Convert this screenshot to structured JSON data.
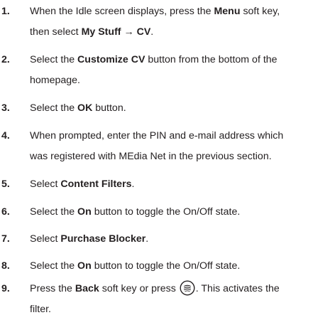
{
  "steps": [
    {
      "number": "1.",
      "line1": [
        "When the Idle screen displays, press the ",
        "Menu",
        " soft key,"
      ],
      "line2": [
        "then select ",
        "My Stuff → CV",
        "."
      ]
    },
    {
      "number": "2.",
      "line1": [
        "Select the ",
        "Customize CV",
        " button from the bottom of the"
      ],
      "line2": [
        "homepage."
      ]
    },
    {
      "number": "3.",
      "line1": [
        "Select the ",
        "OK",
        " button."
      ]
    },
    {
      "number": "4.",
      "line1": [
        "When prompted, enter the PIN and e-mail address which"
      ],
      "line2": [
        "was registered with MEdia Net in the previous section."
      ]
    },
    {
      "number": "5.",
      "line1": [
        "Select ",
        "Content Filters",
        "."
      ]
    },
    {
      "number": "6.",
      "line1": [
        "Select the ",
        "On",
        " button to toggle the On/Off state."
      ]
    },
    {
      "number": "7.",
      "line1": [
        "Select ",
        "Purchase Blocker",
        "."
      ]
    },
    {
      "number": "8.",
      "line1": [
        "Select the ",
        "On",
        " button to toggle the On/Off state."
      ]
    },
    {
      "number": "9.",
      "line1": [
        "Press the ",
        "Back",
        " soft key or press ",
        ".  This activates the"
      ],
      "line2": [
        "filter."
      ],
      "icon": "back-key-icon"
    }
  ]
}
